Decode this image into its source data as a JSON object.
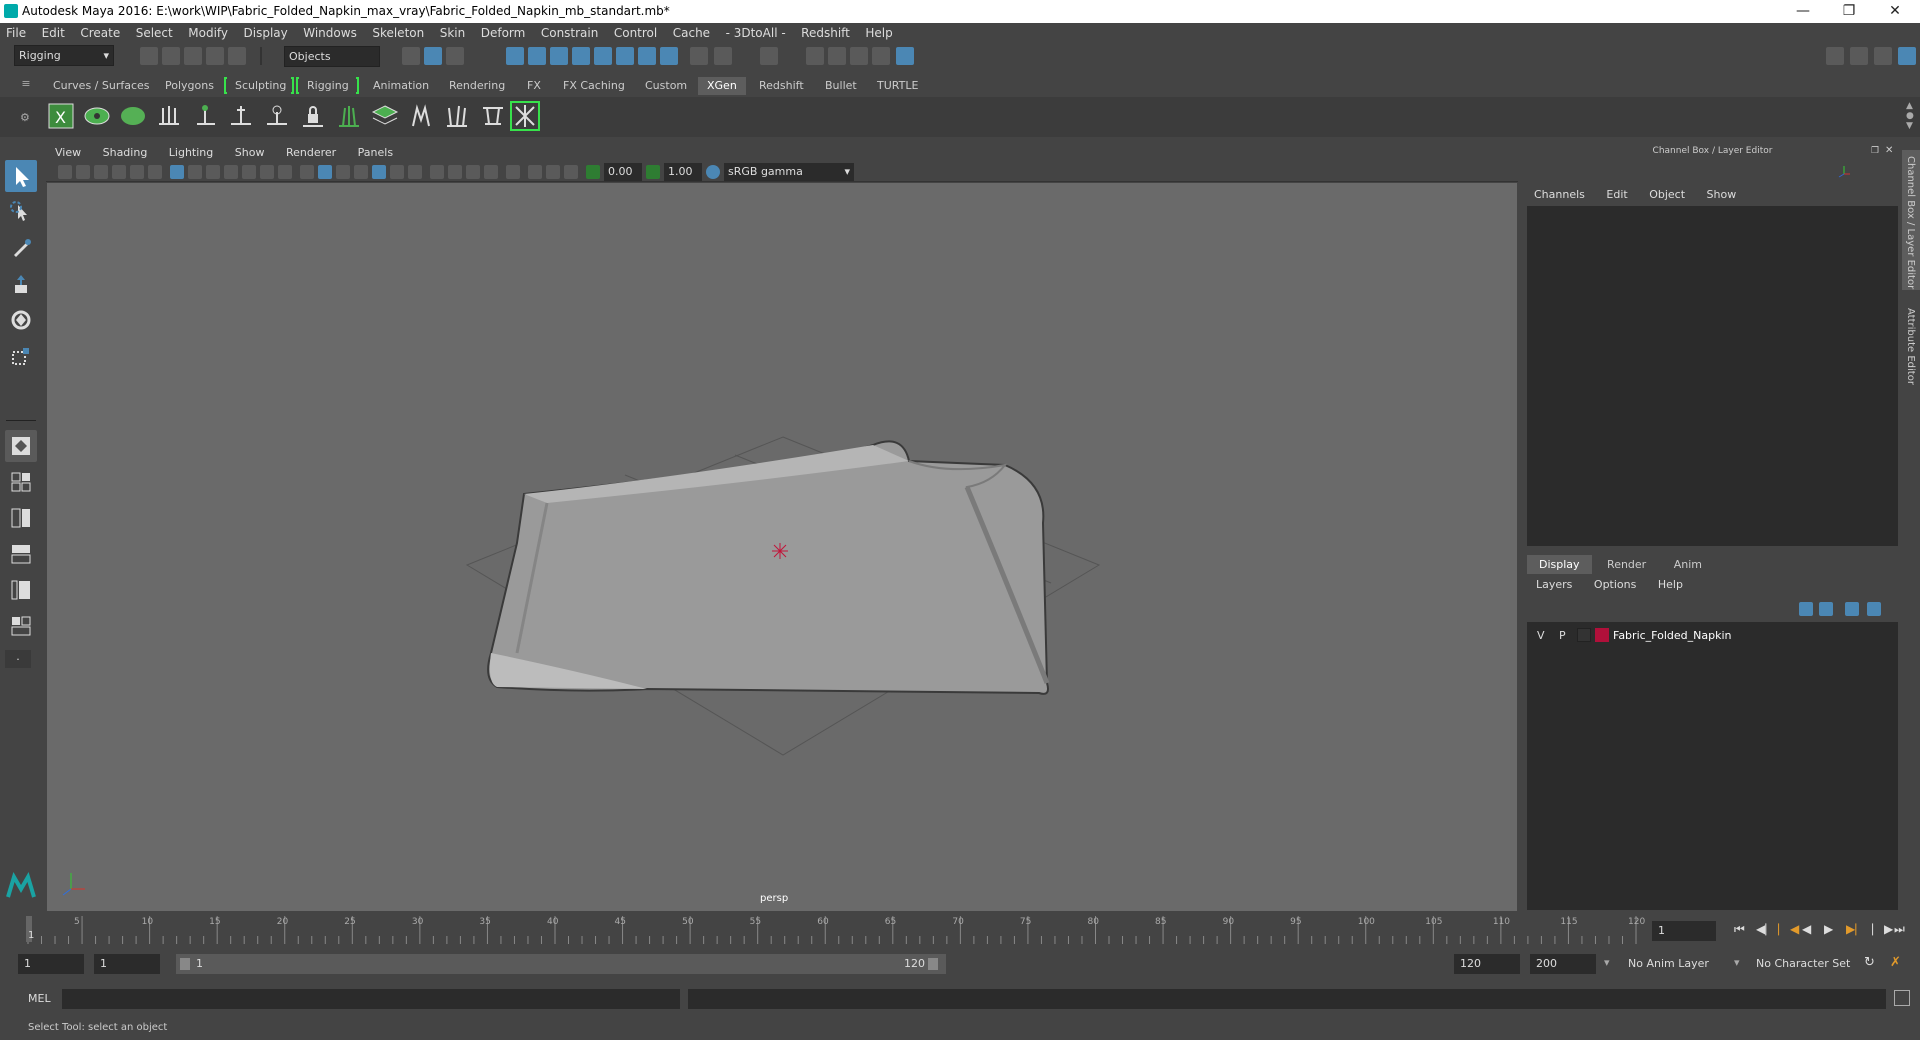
{
  "window": {
    "title": "Autodesk Maya 2016: E:\\work\\WIP\\Fabric_Folded_Napkin_max_vray\\Fabric_Folded_Napkin_mb_standart.mb*"
  },
  "menubar": [
    "File",
    "Edit",
    "Create",
    "Select",
    "Modify",
    "Display",
    "Windows",
    "Skeleton",
    "Skin",
    "Deform",
    "Constrain",
    "Control",
    "Cache",
    "- 3DtoAll -",
    "Redshift",
    "Help"
  ],
  "status": {
    "mode": "Rigging",
    "selection_mask": "Objects"
  },
  "shelf_tabs": [
    "Curves / Surfaces",
    "Polygons",
    "Sculpting",
    "Rigging",
    "Animation",
    "Rendering",
    "FX",
    "FX Caching",
    "Custom",
    "XGen",
    "Redshift",
    "Bullet",
    "TURTLE"
  ],
  "active_shelf": "XGen",
  "viewport": {
    "menu": [
      "View",
      "Shading",
      "Lighting",
      "Show",
      "Renderer",
      "Panels"
    ],
    "exposure": "0.00",
    "gamma": "1.00",
    "color_space": "sRGB gamma",
    "camera": "persp"
  },
  "channel_box": {
    "title": "Channel Box / Layer Editor",
    "menu": [
      "Channels",
      "Edit",
      "Object",
      "Show"
    ],
    "layer_tabs": [
      "Display",
      "Render",
      "Anim"
    ],
    "layer_menu": [
      "Layers",
      "Options",
      "Help"
    ],
    "layer": {
      "v": "V",
      "p": "P",
      "name": "Fabric_Folded_Napkin",
      "color": "#b0103a"
    }
  },
  "side_tabs": {
    "channel": "Channel Box / Layer Editor",
    "attribute": "Attribute Editor"
  },
  "timeline": {
    "ticks": [
      "1",
      "5",
      "10",
      "15",
      "20",
      "25",
      "30",
      "35",
      "40",
      "45",
      "50",
      "55",
      "60",
      "65",
      "70",
      "75",
      "80",
      "85",
      "90",
      "95",
      "100",
      "105",
      "110",
      "115",
      "120"
    ],
    "current_frame": "1"
  },
  "range": {
    "start": "1",
    "playback_start": "1",
    "slider_start": "1",
    "slider_end": "120",
    "end": "120",
    "anim_end": "200",
    "anim_layer": "No Anim Layer",
    "char_set": "No Character Set"
  },
  "command": {
    "label": "MEL"
  },
  "help_line": "Select Tool: select an object",
  "colors": {
    "accent": "#4b87b4",
    "green": "#37e24b"
  }
}
